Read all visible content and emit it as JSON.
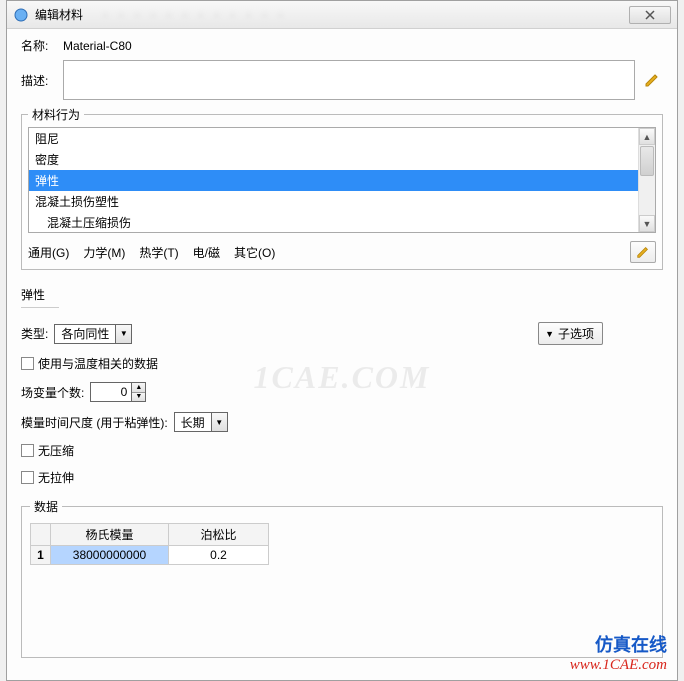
{
  "window": {
    "title": "编辑材料",
    "blur_menu": "· · · · · · · · · · · ·"
  },
  "labels": {
    "name": "名称:",
    "desc": "描述:"
  },
  "name_value": "Material-C80",
  "behavior": {
    "legend": "材料行为",
    "items": [
      {
        "label": "阻尼",
        "selected": false,
        "indent": false
      },
      {
        "label": "密度",
        "selected": false,
        "indent": false
      },
      {
        "label": "弹性",
        "selected": true,
        "indent": false
      },
      {
        "label": "混凝土损伤塑性",
        "selected": false,
        "indent": false
      },
      {
        "label": "混凝土压缩损伤",
        "selected": false,
        "indent": true
      }
    ]
  },
  "tabs": {
    "general": "通用(G)",
    "mechanical": "力学(M)",
    "thermal": "热学(T)",
    "em": "电/磁",
    "other": "其它(O)"
  },
  "section_title": "弹性",
  "form": {
    "type_label": "类型:",
    "type_value": "各向同性",
    "sub_option": "子选项",
    "use_temp": "使用与温度相关的数据",
    "field_vars_label": "场变量个数:",
    "field_vars_value": "0",
    "modulus_time_label": "模量时间尺度 (用于粘弹性):",
    "modulus_time_value": "长期",
    "no_compression": "无压缩",
    "no_tension": "无拉伸"
  },
  "data": {
    "legend": "数据",
    "columns": [
      "杨氏模量",
      "泊松比"
    ],
    "rows": [
      {
        "idx": "1",
        "young": "38000000000",
        "poisson": "0.2"
      }
    ]
  },
  "watermark": "1CAE.COM",
  "brand": {
    "zh": "仿真在线",
    "en": "www.1CAE.com"
  }
}
